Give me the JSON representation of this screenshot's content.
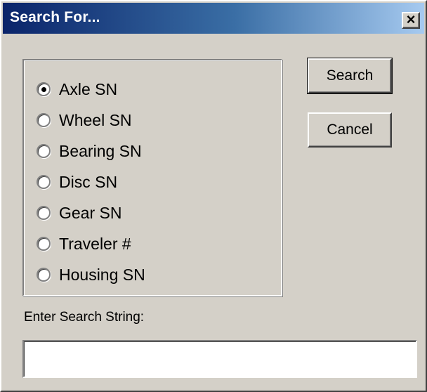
{
  "window": {
    "title": "Search For...",
    "close_label": "×"
  },
  "search_type": {
    "options": [
      {
        "label": "Axle SN",
        "checked": true
      },
      {
        "label": "Wheel SN",
        "checked": false
      },
      {
        "label": "Bearing SN",
        "checked": false
      },
      {
        "label": "Disc SN",
        "checked": false
      },
      {
        "label": "Gear SN",
        "checked": false
      },
      {
        "label": "Traveler #",
        "checked": false
      },
      {
        "label": "Housing SN",
        "checked": false
      }
    ]
  },
  "buttons": {
    "search_label": "Search",
    "cancel_label": "Cancel"
  },
  "search_field": {
    "label": "Enter Search String:",
    "value": "",
    "placeholder": ""
  },
  "colors": {
    "dialog_bg": "#d4d0c8",
    "title_gradient_start": "#0a246a",
    "title_gradient_end": "#a6caf0",
    "title_text": "#ffffff"
  }
}
